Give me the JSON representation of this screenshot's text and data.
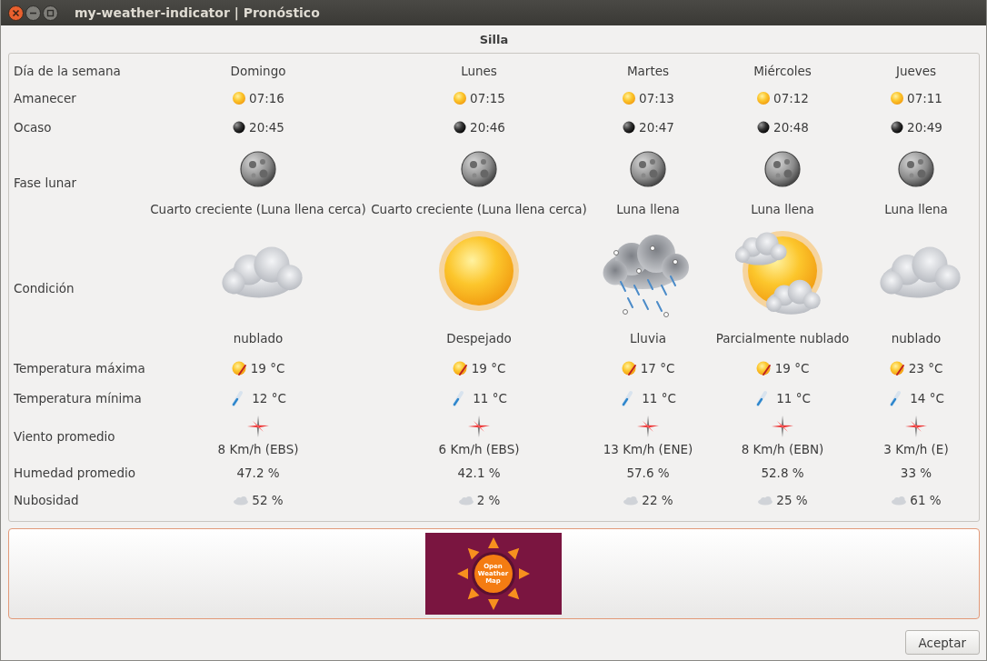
{
  "window": {
    "title": "my-weather-indicator | Pronóstico"
  },
  "location": "Silla",
  "row_labels": [
    "Día de la semana",
    "Amanecer",
    "Ocaso",
    "Fase lunar",
    "Condición",
    "Temperatura máxima",
    "Temperatura mínima",
    "Viento promedio",
    "Humedad promedio",
    "Nubosidad"
  ],
  "days": [
    {
      "name": "Domingo",
      "sunrise": "07:16",
      "sunset": "20:45",
      "moon_phase": "Cuarto creciente (Luna llena cerca)",
      "condition": {
        "kind": "cloudy",
        "text": "nublado"
      },
      "max": "19 °C",
      "min": "12 °C",
      "wind": "8 Km/h (EBS)",
      "humidity": "47.2 %",
      "clouds": "52 %"
    },
    {
      "name": "Lunes",
      "sunrise": "07:15",
      "sunset": "20:46",
      "moon_phase": "Cuarto creciente (Luna llena cerca)",
      "condition": {
        "kind": "clear",
        "text": "Despejado"
      },
      "max": "19 °C",
      "min": "11 °C",
      "wind": "6 Km/h (EBS)",
      "humidity": "42.1 %",
      "clouds": "2 %"
    },
    {
      "name": "Martes",
      "sunrise": "07:13",
      "sunset": "20:47",
      "moon_phase": "Luna llena",
      "condition": {
        "kind": "rain",
        "text": "Lluvia"
      },
      "max": "17 °C",
      "min": "11 °C",
      "wind": "13 Km/h (ENE)",
      "humidity": "57.6 %",
      "clouds": "22 %"
    },
    {
      "name": "Miércoles",
      "sunrise": "07:12",
      "sunset": "20:48",
      "moon_phase": "Luna llena",
      "condition": {
        "kind": "partly_cloudy",
        "text": "Parcialmente nublado"
      },
      "max": "19 °C",
      "min": "11 °C",
      "wind": "8 Km/h (EBN)",
      "humidity": "52.8 %",
      "clouds": "25 %"
    },
    {
      "name": "Jueves",
      "sunrise": "07:11",
      "sunset": "20:49",
      "moon_phase": "Luna llena",
      "condition": {
        "kind": "cloudy",
        "text": "nublado"
      },
      "max": "23 °C",
      "min": "14 °C",
      "wind": "3 Km/h (E)",
      "humidity": "33 %",
      "clouds": "61 %"
    }
  ],
  "logo": {
    "lines": [
      "Open",
      "Weather",
      "Map"
    ]
  },
  "buttons": [
    "Aceptar"
  ]
}
